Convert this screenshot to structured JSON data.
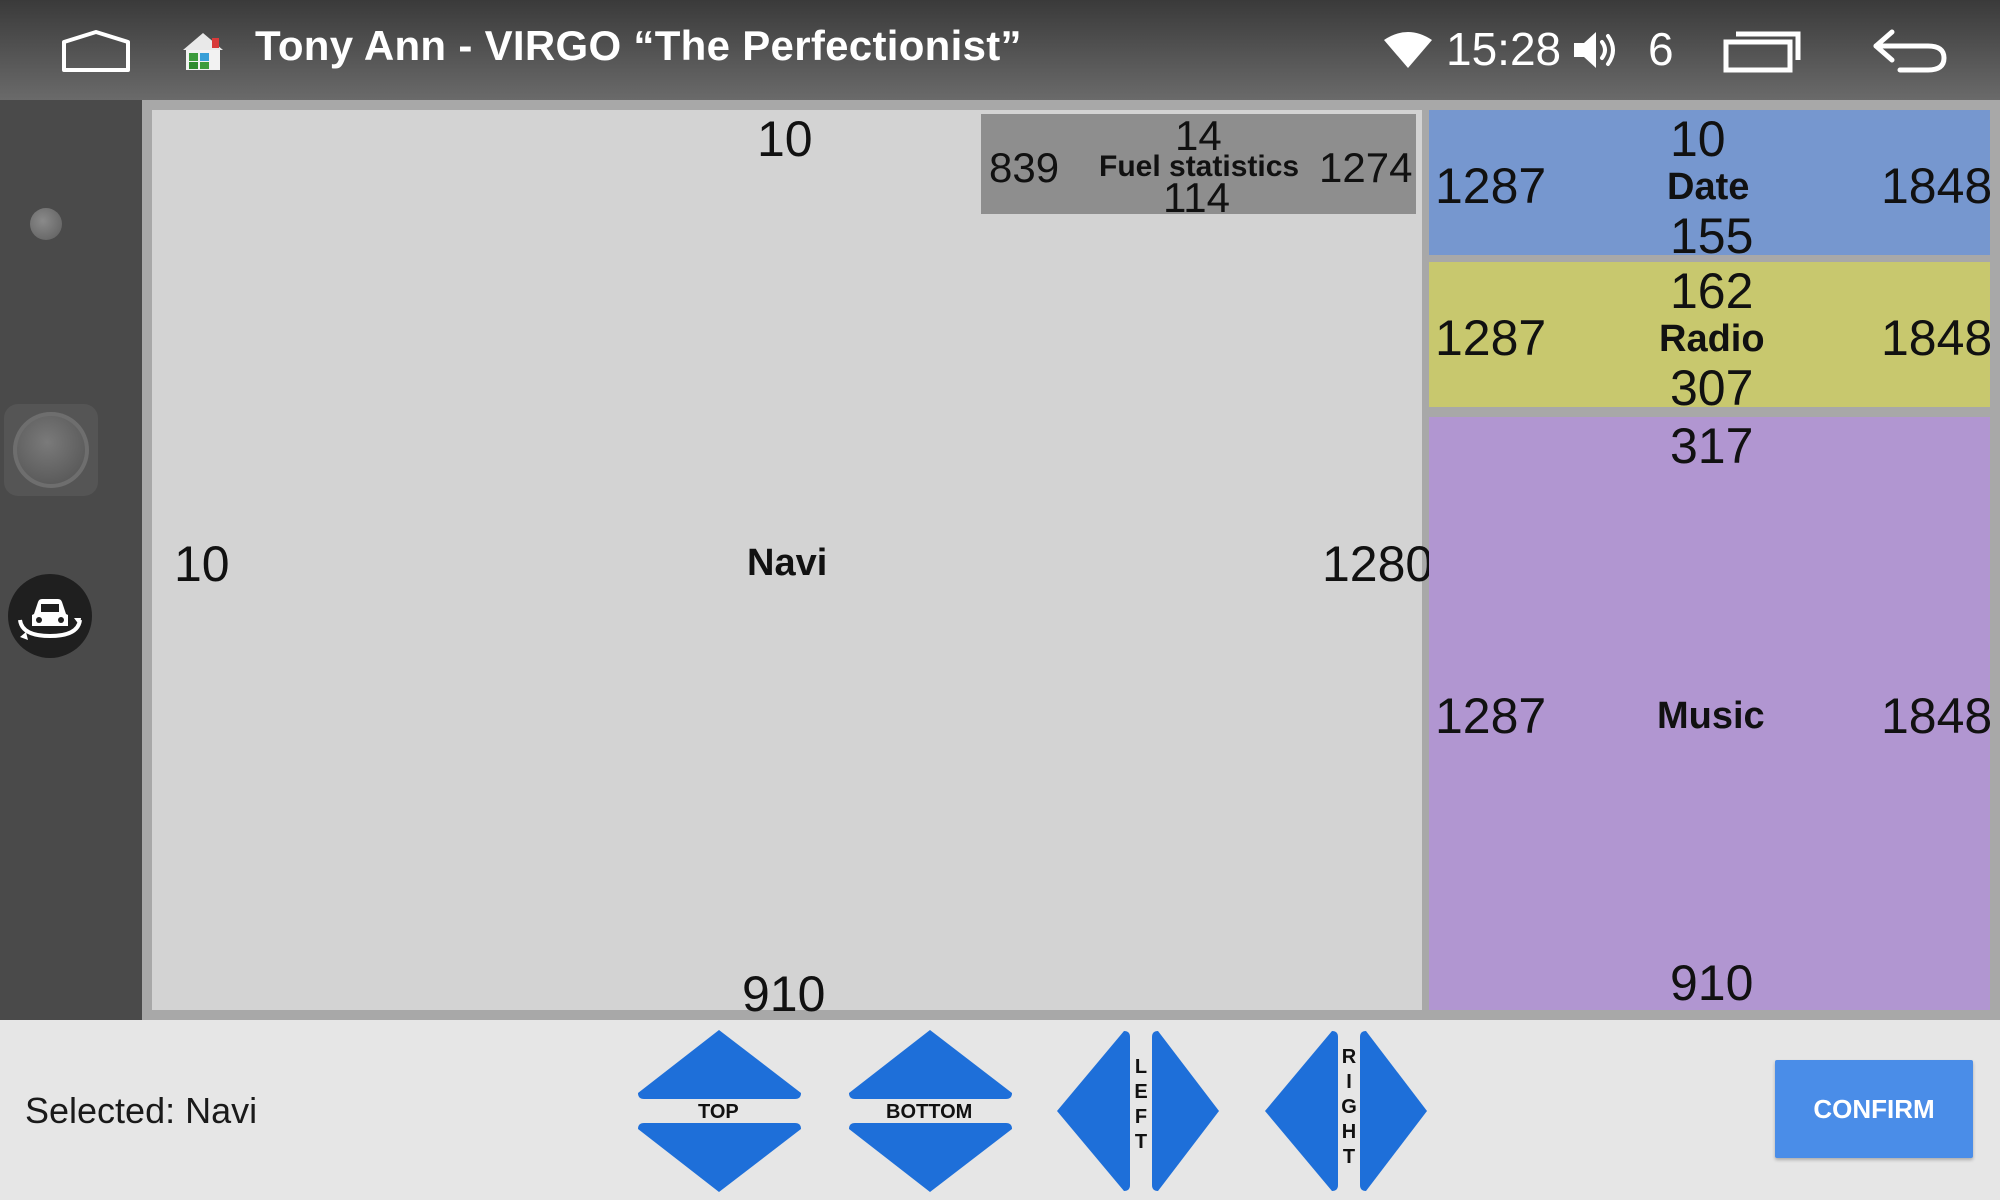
{
  "status_bar": {
    "title": "Tony Ann - VIRGO “The Perfectionist”",
    "time": "15:28",
    "volume": "6",
    "icons": [
      "home-icon",
      "app-launcher-icon",
      "wifi-icon",
      "volume-icon",
      "recent-apps-icon",
      "back-icon"
    ]
  },
  "sidebar": {
    "icons": [
      "dot-indicator-icon",
      "joystick-icon",
      "car-rotate-icon"
    ]
  },
  "zones": {
    "navi": {
      "label": "Navi",
      "top": "10",
      "left": "10",
      "right": "1280",
      "bottom": "910"
    },
    "fuel": {
      "label": "Fuel statistics",
      "top": "14",
      "left": "839",
      "right": "1274",
      "bottom": "114"
    },
    "date": {
      "label": "Date",
      "top": "10",
      "left": "1287",
      "right": "1848",
      "bottom": "155"
    },
    "radio": {
      "label": "Radio",
      "top": "162",
      "left": "1287",
      "right": "1848",
      "bottom": "307"
    },
    "music": {
      "label": "Music",
      "top": "317",
      "left": "1287",
      "right": "1848",
      "bottom": "910"
    }
  },
  "controls": {
    "selected": "Selected: Navi",
    "top_label": "TOP",
    "bottom_label": "BOTTOM",
    "left_label": "L\nE\nF\nT",
    "right_label": "R\nI\nG\nH\nT",
    "confirm_label": "CONFIRM"
  },
  "colors": {
    "navi": "#d3d3d3",
    "fuel": "#8e8e8e",
    "date": "#7697cf",
    "radio": "#c8c86e",
    "music": "#b196d1",
    "arrow": "#1e6fd9",
    "confirm": "#4a8de8"
  }
}
